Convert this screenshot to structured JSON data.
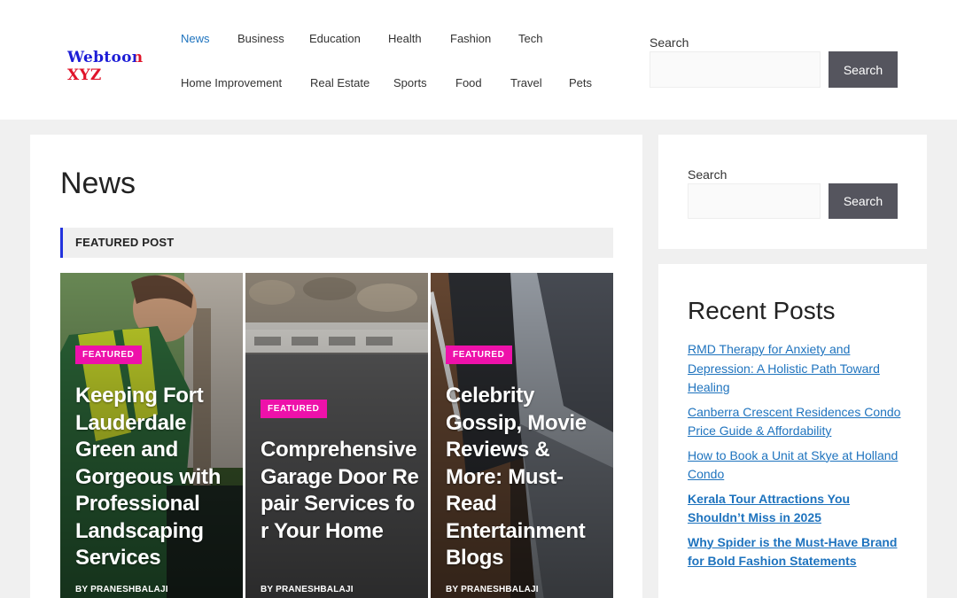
{
  "header": {
    "logo_text": "Webtoon XYZ",
    "nav": [
      {
        "label": "News",
        "active": true
      },
      {
        "label": "Business"
      },
      {
        "label": "Education"
      },
      {
        "label": "Health"
      },
      {
        "label": "Fashion"
      },
      {
        "label": "Tech"
      },
      {
        "label": "Home Improvement"
      },
      {
        "label": "Real Estate"
      },
      {
        "label": "Sports"
      },
      {
        "label": "Food"
      },
      {
        "label": "Travel"
      },
      {
        "label": "Pets"
      }
    ],
    "search_label": "Search",
    "search_button": "Search"
  },
  "main": {
    "page_title": "News",
    "section_label": "FEATURED POST",
    "cards": [
      {
        "badge": "FEATURED",
        "title": "Keeping Fort Lauderdale Green and Gorgeous with Professional Landscaping Services",
        "byline": "BY PRANESHBALAJI"
      },
      {
        "badge": "FEATURED",
        "title": "Comprehensive Garage Door Repair Services for Your Home",
        "byline": "BY PRANESHBALAJI"
      },
      {
        "badge": "FEATURED",
        "title": "Celebrity Gossip, Movie Reviews & More: Must-Read Entertainment Blogs",
        "byline": "BY PRANESHBALAJI"
      }
    ]
  },
  "sidebar": {
    "search_label": "Search",
    "search_button": "Search",
    "recent_title": "Recent Posts",
    "recent_posts": [
      {
        "title": "RMD Therapy for Anxiety and Depression: A Holistic Path Toward Healing"
      },
      {
        "title": "Canberra Crescent Residences Condo Price Guide & Affordability"
      },
      {
        "title": "How to Book a Unit at Skye at Holland Condo"
      },
      {
        "title": "Kerala Tour Attractions You Shouldn’t Miss in 2025"
      },
      {
        "title": "Why Spider is the Must-Have Brand for Bold Fashion Statements"
      }
    ]
  },
  "colors": {
    "link": "#1e73be",
    "badge": "#ee11aa",
    "button": "#55555e",
    "featured_bar_accent": "#2233dd",
    "logo_blue": "#1d1dd6",
    "logo_red": "#e0142a"
  }
}
